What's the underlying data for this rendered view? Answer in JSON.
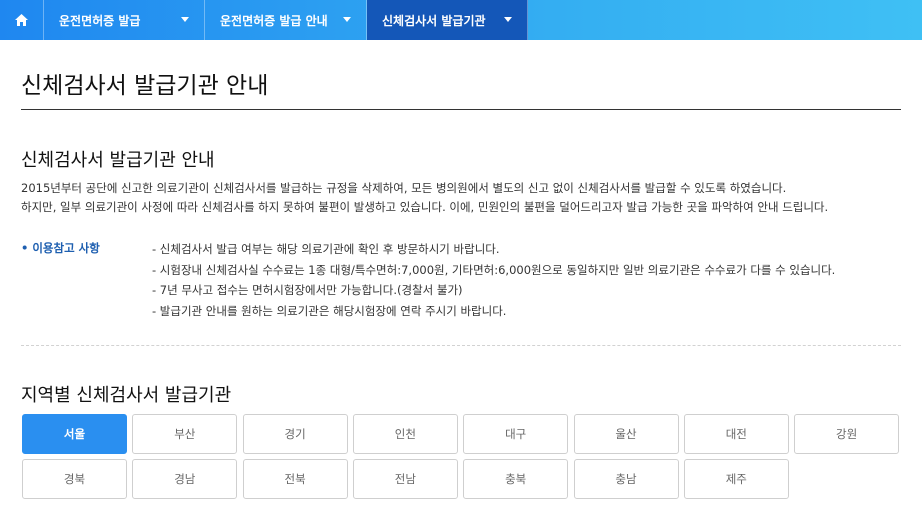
{
  "nav": {
    "home_icon": "home-icon",
    "items": [
      {
        "label": "운전면허증 발급"
      },
      {
        "label": "운전면허증 발급 안내"
      },
      {
        "label": "신체검사서 발급기관"
      }
    ]
  },
  "page_title": "신체검사서 발급기관 안내",
  "section": {
    "title": "신체검사서 발급기관 안내",
    "intro": [
      "2015년부터 공단에 신고한 의료기관이 신체검사서를 발급하는 규정을 삭제하여, 모든 병의원에서 별도의 신고 없이 신체검사서를 발급할 수 있도록 하였습니다.",
      "하지만, 일부 의료기관이 사정에 따라 신체검사를 하지 못하여 불편이 발생하고 있습니다. 이에, 민원인의 불편을 덜어드리고자 발급 가능한 곳을 파악하여 안내 드립니다."
    ],
    "notice_label": "• 이용참고 사항",
    "notices": [
      "- 신체검사서 발급 여부는 해당 의료기관에 확인 후 방문하시기 바랍니다.",
      "- 시험장내 신체검사실 수수료는 1종 대형/특수면허:7,000원, 기타면허:6,000원으로 동일하지만 일반 의료기관은 수수료가 다를 수 있습니다.",
      "- 7년 무사고 접수는 면허시험장에서만 가능합니다.(경찰서 불가)",
      "- 발급기관 안내를 원하는 의료기관은 해당시험장에 연락 주시기 바랍니다."
    ]
  },
  "region": {
    "title": "지역별 신체검사서 발급기관",
    "buttons": [
      "서울",
      "부산",
      "경기",
      "인천",
      "대구",
      "울산",
      "대전",
      "강원",
      "경북",
      "경남",
      "전북",
      "전남",
      "충북",
      "충남",
      "제주"
    ],
    "active": "서울"
  },
  "colors": {
    "nav_gradient_start": "#1f87f0",
    "nav_gradient_end": "#3fc0f4",
    "nav_active": "#1457b8",
    "accent": "#2a8ff0",
    "notice_label": "#1e5fb0"
  }
}
